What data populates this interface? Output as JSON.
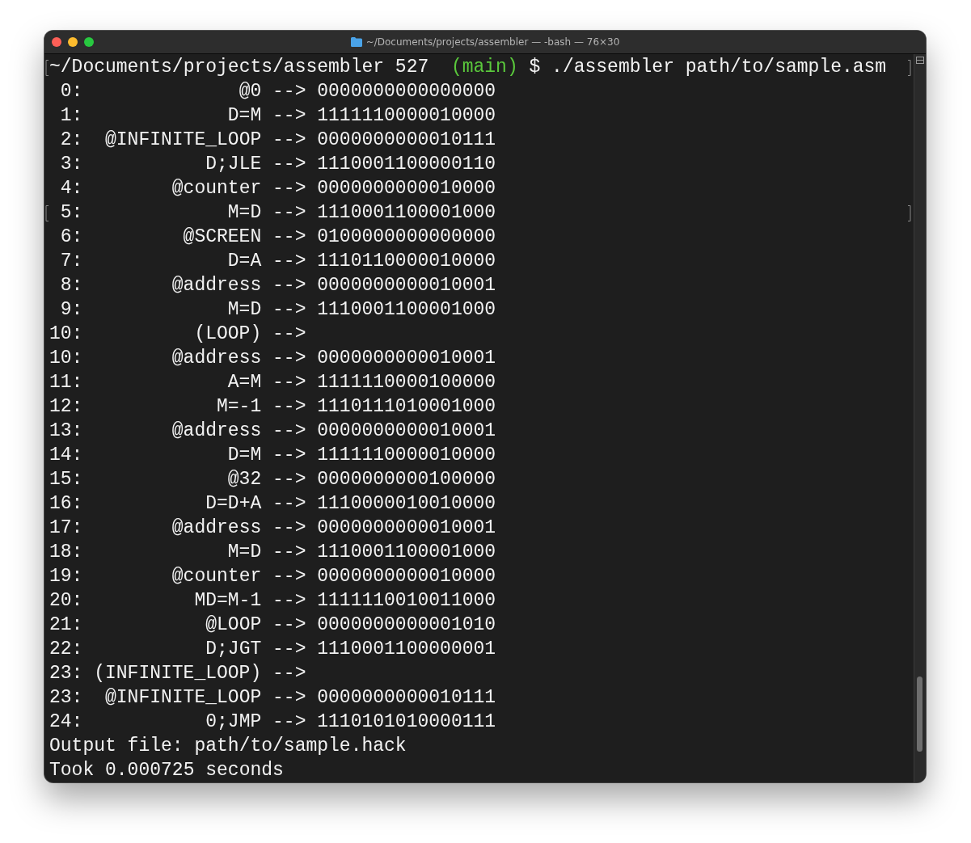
{
  "window": {
    "title": "~/Documents/projects/assembler — -bash — 76×30"
  },
  "prompt": {
    "cwd": "~/Documents/projects/assembler 527",
    "branch": "(main)",
    "command": "$ ./assembler path/to/sample.asm"
  },
  "rows": [
    {
      "index": "0:",
      "instruction": "@0",
      "arrow": "-->",
      "binary": "0000000000000000"
    },
    {
      "index": "1:",
      "instruction": "D=M",
      "arrow": "-->",
      "binary": "1111110000010000"
    },
    {
      "index": "2:",
      "instruction": "@INFINITE_LOOP",
      "arrow": "-->",
      "binary": "0000000000010111"
    },
    {
      "index": "3:",
      "instruction": "D;JLE",
      "arrow": "-->",
      "binary": "1110001100000110"
    },
    {
      "index": "4:",
      "instruction": "@counter",
      "arrow": "-->",
      "binary": "0000000000010000"
    },
    {
      "index": "5:",
      "instruction": "M=D",
      "arrow": "-->",
      "binary": "1110001100001000"
    },
    {
      "index": "6:",
      "instruction": "@SCREEN",
      "arrow": "-->",
      "binary": "0100000000000000"
    },
    {
      "index": "7:",
      "instruction": "D=A",
      "arrow": "-->",
      "binary": "1110110000010000"
    },
    {
      "index": "8:",
      "instruction": "@address",
      "arrow": "-->",
      "binary": "0000000000010001"
    },
    {
      "index": "9:",
      "instruction": "M=D",
      "arrow": "-->",
      "binary": "1110001100001000"
    },
    {
      "index": "10:",
      "instruction": "(LOOP)",
      "arrow": "-->"
    },
    {
      "index": "10:",
      "instruction": "@address",
      "arrow": "-->",
      "binary": "0000000000010001"
    },
    {
      "index": "11:",
      "instruction": "A=M",
      "arrow": "-->",
      "binary": "1111110000100000"
    },
    {
      "index": "12:",
      "instruction": "M=-1",
      "arrow": "-->",
      "binary": "1110111010001000"
    },
    {
      "index": "13:",
      "instruction": "@address",
      "arrow": "-->",
      "binary": "0000000000010001"
    },
    {
      "index": "14:",
      "instruction": "D=M",
      "arrow": "-->",
      "binary": "1111110000010000"
    },
    {
      "index": "15:",
      "instruction": "@32",
      "arrow": "-->",
      "binary": "0000000000100000"
    },
    {
      "index": "16:",
      "instruction": "D=D+A",
      "arrow": "-->",
      "binary": "1110000010010000"
    },
    {
      "index": "17:",
      "instruction": "@address",
      "arrow": "-->",
      "binary": "0000000000010001"
    },
    {
      "index": "18:",
      "instruction": "M=D",
      "arrow": "-->",
      "binary": "1110001100001000"
    },
    {
      "index": "19:",
      "instruction": "@counter",
      "arrow": "-->",
      "binary": "0000000000010000"
    },
    {
      "index": "20:",
      "instruction": "MD=M-1",
      "arrow": "-->",
      "binary": "1111110010011000"
    },
    {
      "index": "21:",
      "instruction": "@LOOP",
      "arrow": "-->",
      "binary": "0000000000001010"
    },
    {
      "index": "22:",
      "instruction": "D;JGT",
      "arrow": "-->",
      "binary": "1110001100000001"
    },
    {
      "index": "23:",
      "instruction": "(INFINITE_LOOP)",
      "arrow": "-->"
    },
    {
      "index": "23:",
      "instruction": "@INFINITE_LOOP",
      "arrow": "-->",
      "binary": "0000000000010111"
    },
    {
      "index": "24:",
      "instruction": "0;JMP",
      "arrow": "-->",
      "binary": "1110101010000111"
    }
  ],
  "output": [
    "Output file: path/to/sample.hack",
    "Took 0.000725 seconds"
  ]
}
